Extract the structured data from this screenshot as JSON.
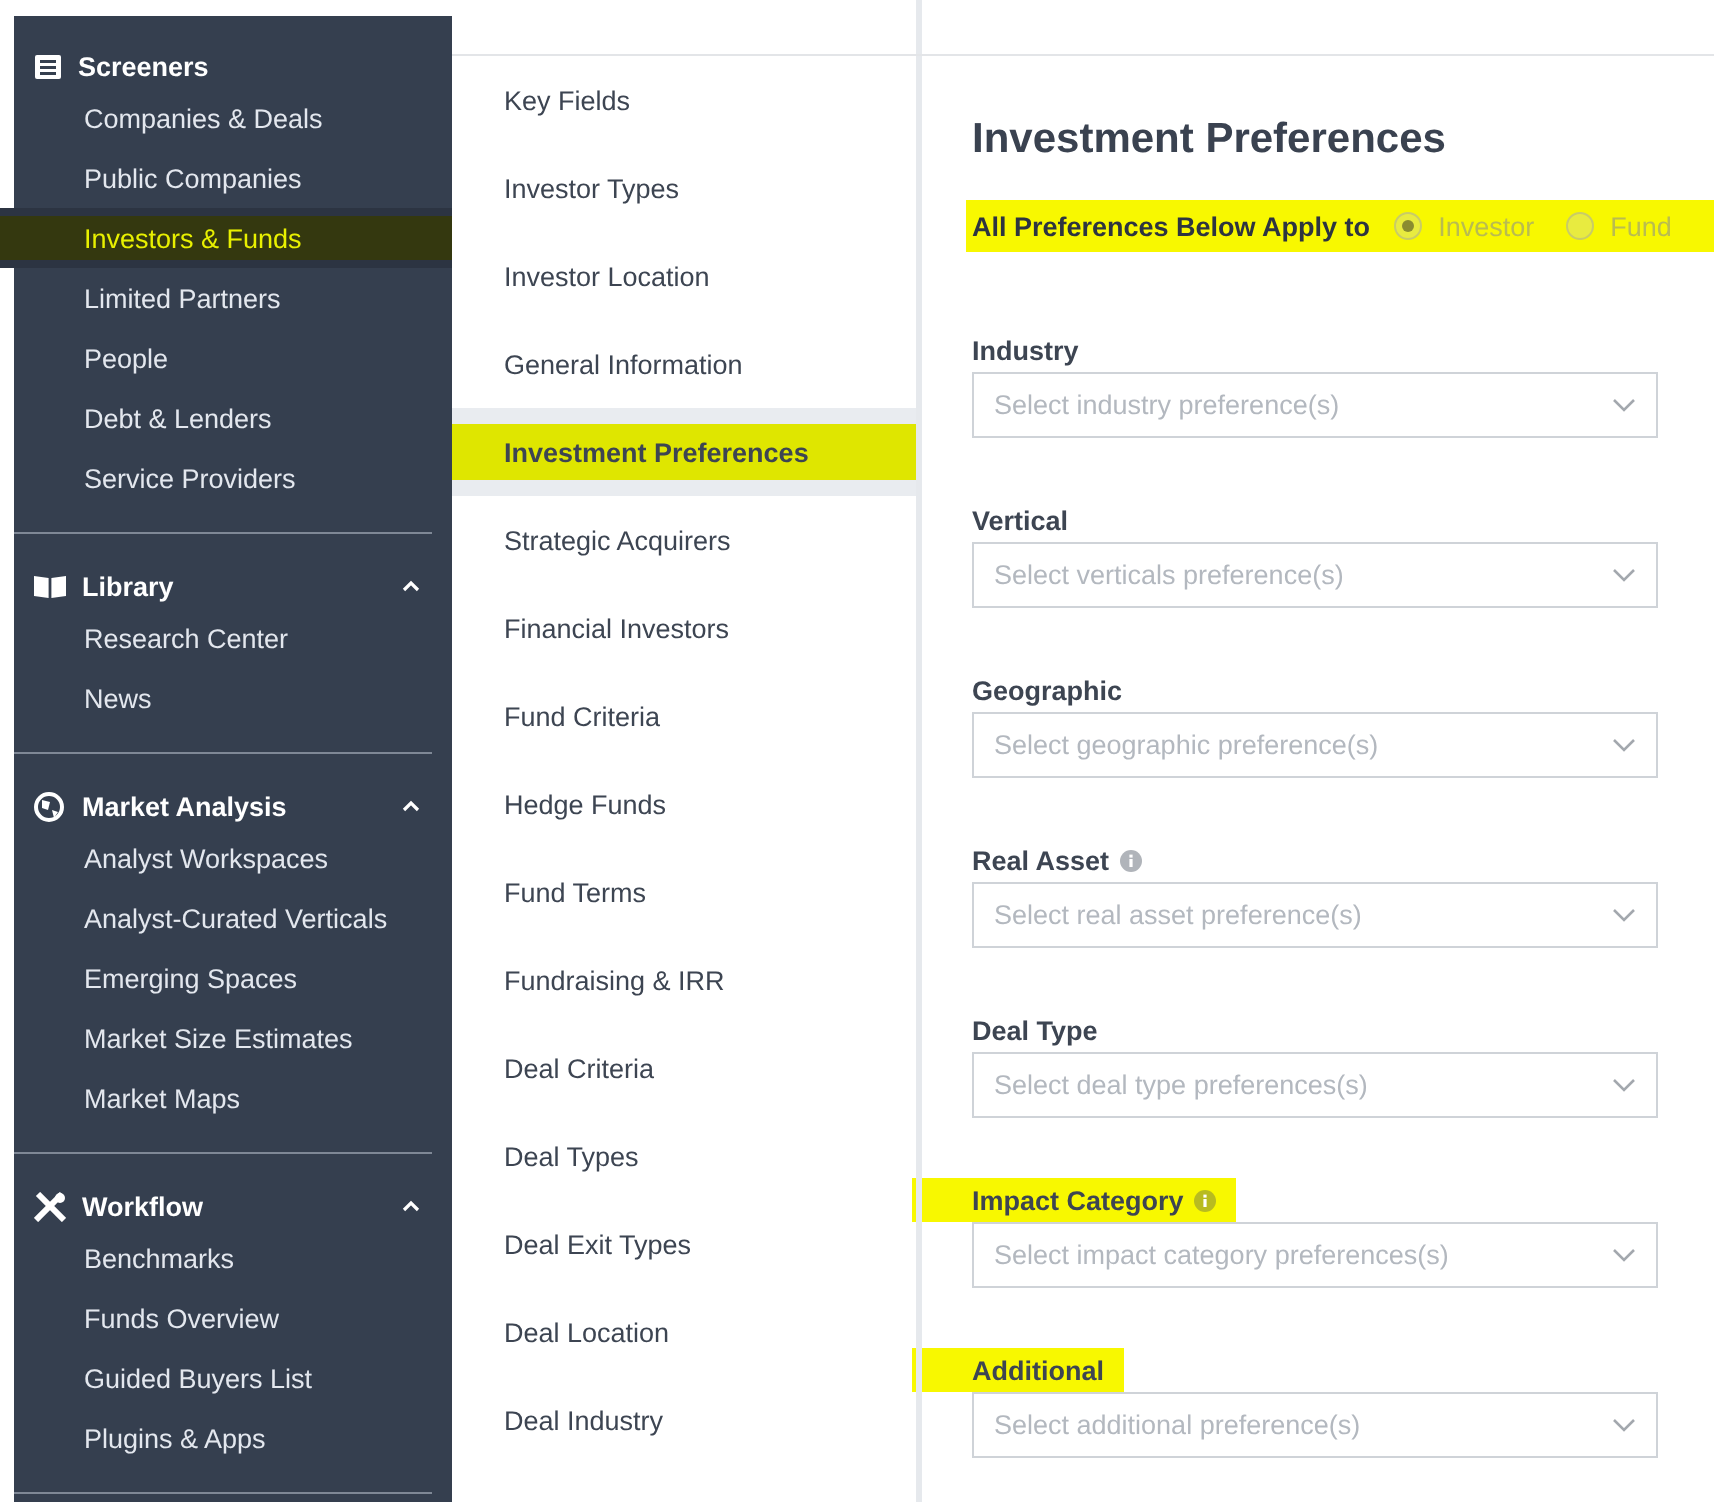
{
  "sidebar": {
    "sections": [
      {
        "title": "Screeners",
        "items": [
          {
            "label": "Companies & Deals",
            "selected": false,
            "highlighted": false
          },
          {
            "label": "Public Companies",
            "selected": false,
            "highlighted": false
          },
          {
            "label": "Investors & Funds",
            "selected": true,
            "highlighted": true
          },
          {
            "label": "Limited Partners",
            "selected": false,
            "highlighted": false
          },
          {
            "label": "People",
            "selected": false,
            "highlighted": false
          },
          {
            "label": "Debt & Lenders",
            "selected": false,
            "highlighted": false
          },
          {
            "label": "Service Providers",
            "selected": false,
            "highlighted": false
          }
        ]
      },
      {
        "title": "Library",
        "expanded": true,
        "items": [
          {
            "label": "Research Center",
            "selected": false,
            "highlighted": false
          },
          {
            "label": "News",
            "selected": false,
            "highlighted": false
          }
        ]
      },
      {
        "title": "Market Analysis",
        "expanded": true,
        "items": [
          {
            "label": "Analyst Workspaces",
            "selected": false,
            "highlighted": false
          },
          {
            "label": "Analyst-Curated Verticals",
            "selected": false,
            "highlighted": false
          },
          {
            "label": "Emerging Spaces",
            "selected": false,
            "highlighted": false
          },
          {
            "label": "Market Size Estimates",
            "selected": false,
            "highlighted": false
          },
          {
            "label": "Market Maps",
            "selected": false,
            "highlighted": false
          }
        ]
      },
      {
        "title": "Workflow",
        "expanded": true,
        "items": [
          {
            "label": "Benchmarks",
            "selected": false,
            "highlighted": false
          },
          {
            "label": "Funds Overview",
            "selected": false,
            "highlighted": false
          },
          {
            "label": "Guided Buyers List",
            "selected": false,
            "highlighted": false
          },
          {
            "label": "Plugins & Apps",
            "selected": false,
            "highlighted": false
          }
        ]
      }
    ]
  },
  "sections_nav": {
    "items": [
      {
        "label": "Key Fields",
        "selected": false,
        "highlighted": false
      },
      {
        "label": "Investor Types",
        "selected": false,
        "highlighted": false
      },
      {
        "label": "Investor Location",
        "selected": false,
        "highlighted": false
      },
      {
        "label": "General Information",
        "selected": false,
        "highlighted": false
      },
      {
        "label": "Investment Preferences",
        "selected": true,
        "highlighted": true
      },
      {
        "label": "Strategic Acquirers",
        "selected": false,
        "highlighted": false
      },
      {
        "label": "Financial Investors",
        "selected": false,
        "highlighted": false
      },
      {
        "label": "Fund Criteria",
        "selected": false,
        "highlighted": false
      },
      {
        "label": "Hedge Funds",
        "selected": false,
        "highlighted": false
      },
      {
        "label": "Fund Terms",
        "selected": false,
        "highlighted": false
      },
      {
        "label": "Fundraising & IRR",
        "selected": false,
        "highlighted": false
      },
      {
        "label": "Deal Criteria",
        "selected": false,
        "highlighted": false
      },
      {
        "label": "Deal Types",
        "selected": false,
        "highlighted": false
      },
      {
        "label": "Deal Exit Types",
        "selected": false,
        "highlighted": false
      },
      {
        "label": "Deal Location",
        "selected": false,
        "highlighted": false
      },
      {
        "label": "Deal Industry",
        "selected": false,
        "highlighted": false
      }
    ]
  },
  "main": {
    "title": "Investment Preferences",
    "apply_to": {
      "label": "All Preferences Below Apply to",
      "highlighted": true,
      "options": [
        {
          "label": "Investor",
          "selected": true
        },
        {
          "label": "Fund",
          "selected": false
        }
      ]
    },
    "fields": [
      {
        "label": "Industry",
        "highlighted": false,
        "placeholder": "Select industry preference(s)"
      },
      {
        "label": "Vertical",
        "highlighted": false,
        "placeholder": "Select verticals preference(s)"
      },
      {
        "label": "Geographic",
        "highlighted": false,
        "placeholder": "Select geographic preference(s)"
      },
      {
        "label": "Real Asset",
        "info": true,
        "highlighted": false,
        "placeholder": "Select real asset preference(s)"
      },
      {
        "label": "Deal Type",
        "highlighted": false,
        "placeholder": "Select deal type preferences(s)"
      },
      {
        "label": "Impact Category",
        "info": true,
        "highlighted": true,
        "placeholder": "Select impact category preferences(s)"
      },
      {
        "label": "Additional",
        "highlighted": true,
        "placeholder": "Select additional preference(s)"
      }
    ]
  }
}
